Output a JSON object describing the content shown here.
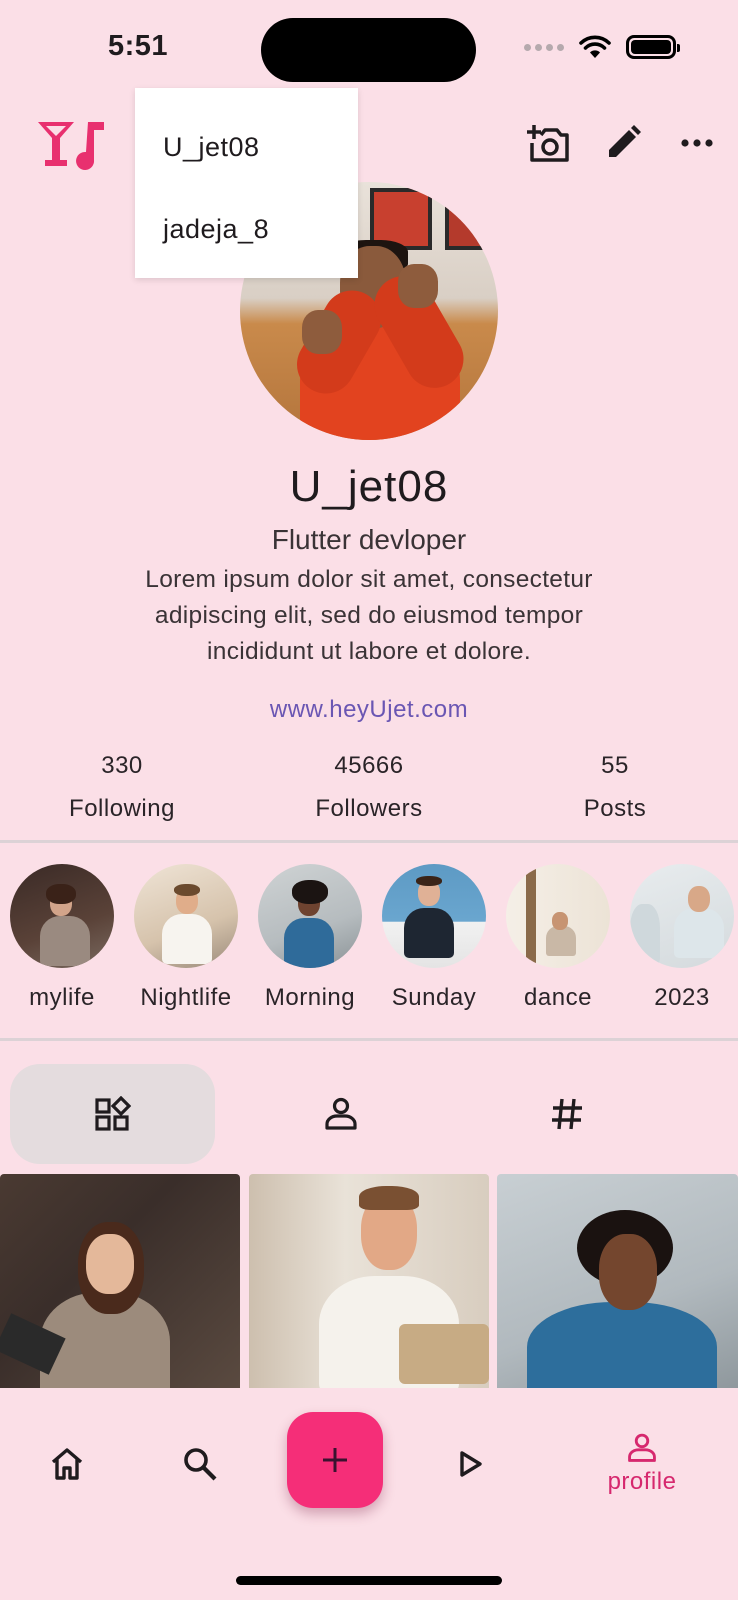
{
  "status_bar": {
    "time": "5:51"
  },
  "account_menu": {
    "items": [
      "U_jet08",
      "jadeja_8"
    ]
  },
  "profile": {
    "name": "U_jet08",
    "title": "Flutter devloper",
    "bio": "Lorem ipsum dolor sit amet, consectetur adipiscing elit, sed do eiusmod tempor incididunt ut labore et dolore.",
    "link": "www.heyUjet.com"
  },
  "stats": [
    {
      "value": "330",
      "label": "Following"
    },
    {
      "value": "45666",
      "label": "Followers"
    },
    {
      "value": "55",
      "label": "Posts"
    }
  ],
  "highlights": [
    {
      "label": "mylife"
    },
    {
      "label": "Nightlife"
    },
    {
      "label": "Morning"
    },
    {
      "label": "Sunday"
    },
    {
      "label": "dance"
    },
    {
      "label": "2023"
    }
  ],
  "tabs": [
    {
      "icon": "grid-shapes-icon",
      "active": true
    },
    {
      "icon": "person-tag-icon",
      "active": false
    },
    {
      "icon": "hashtag-icon",
      "active": false
    }
  ],
  "bottom_nav": {
    "items": [
      {
        "icon": "home-icon"
      },
      {
        "icon": "search-icon"
      },
      {
        "icon": "add-icon"
      },
      {
        "icon": "play-icon"
      },
      {
        "icon": "profile-icon",
        "label": "profile",
        "active": true
      }
    ]
  },
  "colors": {
    "background": "#fbdfe7",
    "accent": "#f52e78",
    "active_nav": "#d6286e",
    "link": "#6a56b3",
    "logo": "#e8306f"
  }
}
